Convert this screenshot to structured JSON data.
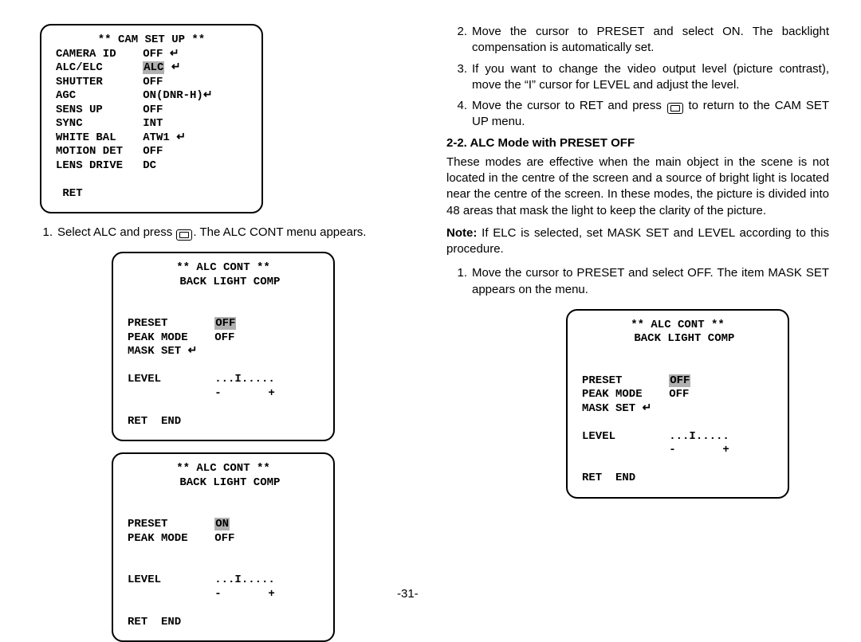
{
  "arrow": "↵",
  "panel1": {
    "title": "** CAM SET UP **",
    "r1a": "CAMERA ID    ",
    "r1b": "OFF ",
    "r2a": "ALC/ELC      ",
    "r2b_hl": "ALC",
    "r2c": " ",
    "r3a": "SHUTTER      ",
    "r3b": "OFF",
    "r4a": "AGC          ",
    "r4b": "ON(DNR-H)",
    "r5a": "SENS UP      ",
    "r5b": "OFF",
    "r6a": "SYNC         ",
    "r6b": "INT",
    "r7a": "WHITE BAL    ",
    "r7b": "ATW1 ",
    "r8a": "MOTION DET   ",
    "r8b": "OFF",
    "r9a": "LENS DRIVE   ",
    "r9b": "DC",
    "ret": " RET"
  },
  "l1": {
    "num": "1.",
    "t1": "Select ALC and press ",
    "t2": ". The ALC CONT menu appears."
  },
  "panel2": {
    "title": "** ALC CONT **",
    "sub": "  BACK LIGHT COMP",
    "r1a": "PRESET       ",
    "r1b_hl": "OFF",
    "r2a": "PEAK MODE    ",
    "r2b": "OFF",
    "r3a": "MASK SET ",
    "lvl_a": "LEVEL        ",
    "lvl_b": "...I.....",
    "pm": "             -       +",
    "ret": "RET  END"
  },
  "panel3": {
    "title": "** ALC CONT **",
    "sub": "  BACK LIGHT COMP",
    "r1a": "PRESET       ",
    "r1b_hl": "ON",
    "r2a": "PEAK MODE    ",
    "r2b": "OFF",
    "lvl_a": "LEVEL        ",
    "lvl_b": "...I.....",
    "pm": "             -       +",
    "ret": "RET  END"
  },
  "r1": {
    "num": "2.",
    "t1": "Move the cursor to PRESET and select ON. The backlight compensation is automatically set."
  },
  "r2": {
    "num": "3.",
    "t1": "If you want to change the video output level (picture contrast), move the “I” cursor for LEVEL and adjust the level."
  },
  "r3": {
    "num": "4.",
    "t1": "Move the cursor to RET and press ",
    "t2": " to return to the CAM SET UP menu."
  },
  "section": "2-2. ALC Mode with PRESET OFF",
  "para1": "These modes are effective when the main object in the scene is not located in the centre of the screen and a source of bright light is located near the centre of the screen. In these modes, the picture is divided into 48 areas that mask the light to keep the clarity of the picture.",
  "note_lbl": "Note:",
  "note_txt": " If ELC is selected, set MASK SET and LEVEL according to this procedure.",
  "r4": {
    "num": "1.",
    "t1": "Move the cursor to PRESET and select OFF. The item MASK SET appears on the menu."
  },
  "panel4": {
    "title": "** ALC CONT **",
    "sub": "  BACK LIGHT COMP",
    "r1a": "PRESET       ",
    "r1b_hl": "OFF",
    "r2a": "PEAK MODE    ",
    "r2b": "OFF",
    "r3a": "MASK SET ",
    "lvl_a": "LEVEL        ",
    "lvl_b": "...I.....",
    "pm": "             -       +",
    "ret": "RET  END"
  },
  "pagenum": "-31-"
}
